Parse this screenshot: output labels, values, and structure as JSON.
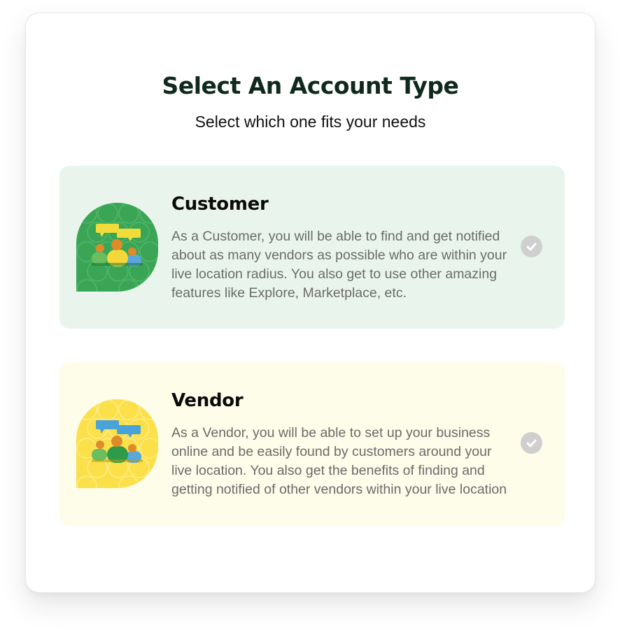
{
  "header": {
    "title": "Select An Account Type",
    "subtitle": "Select which one fits your needs"
  },
  "options": [
    {
      "id": "customer",
      "title": "Customer",
      "description": "As a Customer, you will be able to find and get notified about as many vendors as possible who are within your live location radius. You also get to use other amazing features like Explore, Marketplace, etc.",
      "icon": "people-chat-icon",
      "blob_color": "#3aa655",
      "card_color": "#e9f5ec"
    },
    {
      "id": "vendor",
      "title": "Vendor",
      "description": "As a Vendor, you will be able to set up your business online and be easily found by customers around your live location. You also get the benefits of finding and getting notified of other vendors within your live location",
      "icon": "people-chat-icon",
      "blob_color": "#fbe04a",
      "card_color": "#fefde9"
    }
  ],
  "check_icon": "check-circle-icon",
  "check_color": "#cfcfcf"
}
